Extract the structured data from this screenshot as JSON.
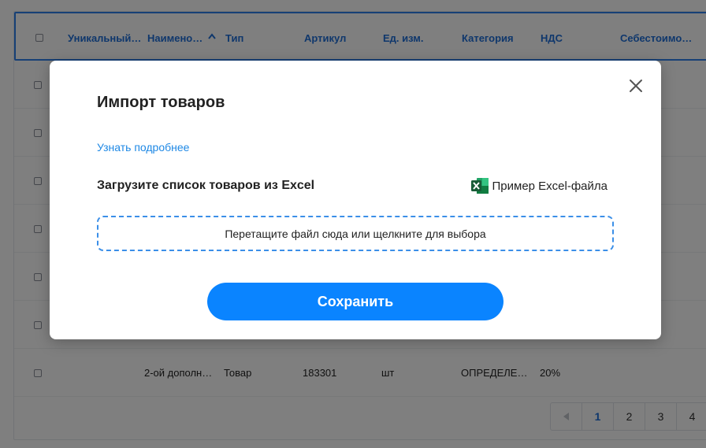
{
  "table": {
    "headers": [
      "Уникальный…",
      "Наимено…",
      "Тип",
      "Артикул",
      "Ед. изм.",
      "Категория",
      "НДС",
      "Себестоимо…"
    ],
    "last_row": {
      "name": "2-ой дополн…",
      "type": "Товар",
      "article": "183301",
      "unit": "шт",
      "category": "ОПРЕДЕЛЕ…",
      "vat": "20%"
    }
  },
  "pagination": {
    "prev_icon": "triangle-left-icon",
    "pages": [
      "1",
      "2",
      "3",
      "4"
    ],
    "active_page": "1"
  },
  "modal": {
    "title": "Импорт товаров",
    "learn_more": "Узнать подробнее",
    "upload_label": "Загрузите список товаров из Excel",
    "example_link": "Пример Excel-файла",
    "dropzone_text": "Перетащите файл сюда или щелкните для выбора",
    "save_button": "Сохранить",
    "close_icon": "close-icon"
  },
  "colors": {
    "accent": "#0a84ff",
    "link": "#1e88e5",
    "header_text": "#1e6fd9",
    "excel_green": "#1d6f42"
  }
}
